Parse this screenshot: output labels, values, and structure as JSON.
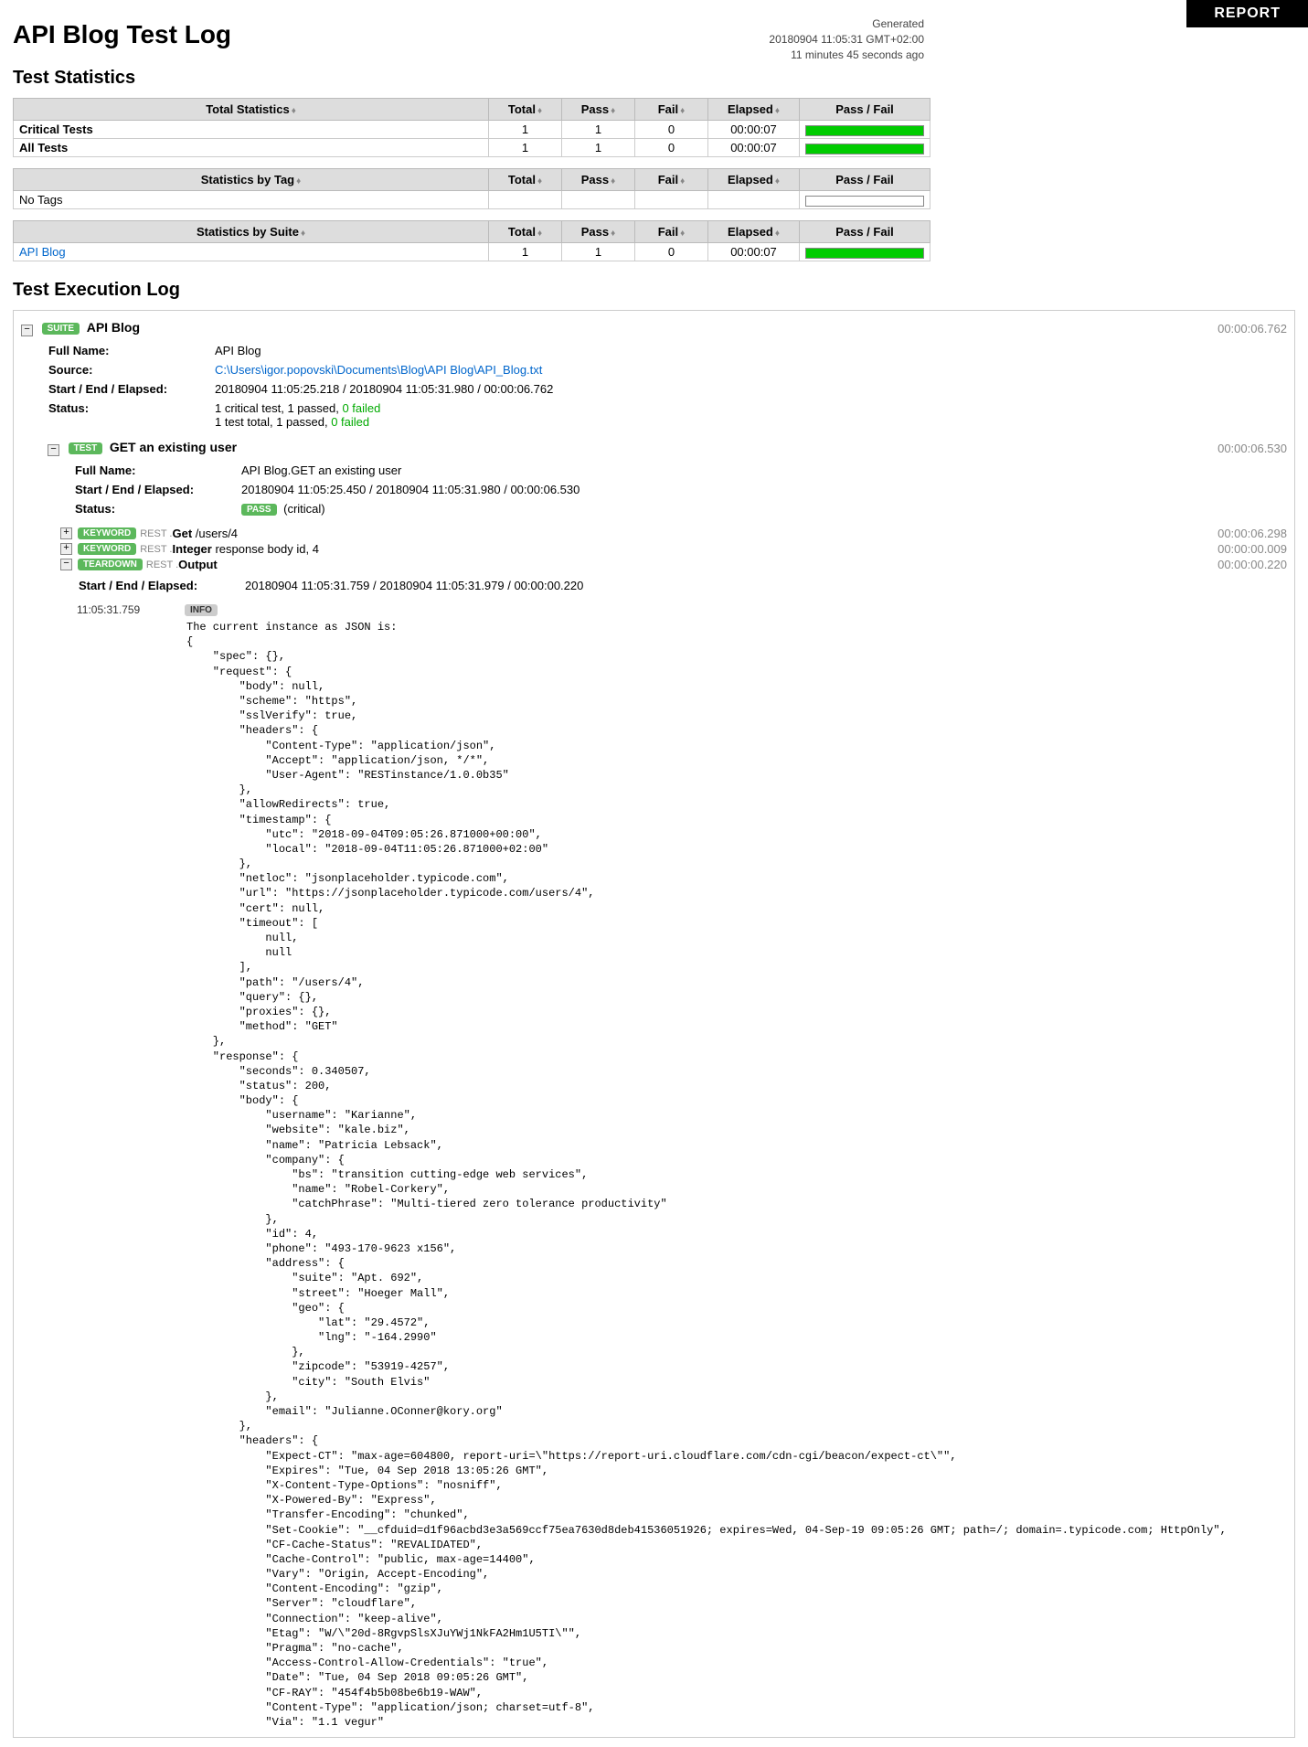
{
  "report_button": "REPORT",
  "title": "API Blog Test Log",
  "generated": {
    "label": "Generated",
    "datetime": "20180904 11:05:31 GMT+02:00",
    "ago": "11 minutes 45 seconds ago"
  },
  "sections": {
    "stats": "Test Statistics",
    "exec": "Test Execution Log"
  },
  "stat_headers": [
    "Total",
    "Pass",
    "Fail",
    "Elapsed",
    "Pass / Fail"
  ],
  "stat_group1": {
    "header": "Total Statistics",
    "rows": [
      {
        "name": "Critical Tests",
        "total": "1",
        "pass": "1",
        "fail": "0",
        "elapsed": "00:00:07",
        "bar": true
      },
      {
        "name": "All Tests",
        "total": "1",
        "pass": "1",
        "fail": "0",
        "elapsed": "00:00:07",
        "bar": true
      }
    ]
  },
  "stat_group2": {
    "header": "Statistics by Tag",
    "rows": [
      {
        "name": "No Tags",
        "total": "",
        "pass": "",
        "fail": "",
        "elapsed": "",
        "bar": false
      }
    ]
  },
  "stat_group3": {
    "header": "Statistics by Suite",
    "rows": [
      {
        "name": "API Blog",
        "link": true,
        "total": "1",
        "pass": "1",
        "fail": "0",
        "elapsed": "00:00:07",
        "bar": true
      }
    ]
  },
  "suite": {
    "badge": "SUITE",
    "name": "API Blog",
    "elapsed": "00:00:06.762",
    "full_name_label": "Full Name:",
    "full_name": "API Blog",
    "source_label": "Source:",
    "source": "C:\\Users\\igor.popovski\\Documents\\Blog\\API Blog\\API_Blog.txt",
    "see_label": "Start / End / Elapsed:",
    "see": "20180904 11:05:25.218 / 20180904 11:05:31.980 / 00:00:06.762",
    "status_label": "Status:",
    "status_line1a": "1 critical test, 1 passed, ",
    "status_line1b": "0 failed",
    "status_line2a": "1 test total, 1 passed, ",
    "status_line2b": "0 failed"
  },
  "test": {
    "badge": "TEST",
    "name": "GET an existing user",
    "elapsed": "00:00:06.530",
    "full_name_label": "Full Name:",
    "full_name": "API Blog.GET an existing user",
    "see_label": "Start / End / Elapsed:",
    "see": "20180904 11:05:25.450 / 20180904 11:05:31.980 / 00:00:06.530",
    "status_label": "Status:",
    "status_badge": "PASS",
    "status_extra": "(critical)"
  },
  "kw1": {
    "badge": "KEYWORD",
    "lib": "REST .",
    "name": "Get",
    "args": "/users/4",
    "elapsed": "00:00:06.298"
  },
  "kw2": {
    "badge": "KEYWORD",
    "lib": "REST .",
    "name": "Integer",
    "args": "response body id, 4",
    "elapsed": "00:00:00.009"
  },
  "teardown": {
    "badge": "TEARDOWN",
    "lib": "REST .",
    "name": "Output",
    "elapsed": "00:00:00.220",
    "see_label": "Start / End / Elapsed:",
    "see": "20180904 11:05:31.759 / 20180904 11:05:31.979 / 00:00:00.220",
    "timestamp": "11:05:31.759",
    "info_badge": "INFO"
  },
  "json_output": "The current instance as JSON is:\n{\n    \"spec\": {},\n    \"request\": {\n        \"body\": null,\n        \"scheme\": \"https\",\n        \"sslVerify\": true,\n        \"headers\": {\n            \"Content-Type\": \"application/json\",\n            \"Accept\": \"application/json, */*\",\n            \"User-Agent\": \"RESTinstance/1.0.0b35\"\n        },\n        \"allowRedirects\": true,\n        \"timestamp\": {\n            \"utc\": \"2018-09-04T09:05:26.871000+00:00\",\n            \"local\": \"2018-09-04T11:05:26.871000+02:00\"\n        },\n        \"netloc\": \"jsonplaceholder.typicode.com\",\n        \"url\": \"https://jsonplaceholder.typicode.com/users/4\",\n        \"cert\": null,\n        \"timeout\": [\n            null,\n            null\n        ],\n        \"path\": \"/users/4\",\n        \"query\": {},\n        \"proxies\": {},\n        \"method\": \"GET\"\n    },\n    \"response\": {\n        \"seconds\": 0.340507,\n        \"status\": 200,\n        \"body\": {\n            \"username\": \"Karianne\",\n            \"website\": \"kale.biz\",\n            \"name\": \"Patricia Lebsack\",\n            \"company\": {\n                \"bs\": \"transition cutting-edge web services\",\n                \"name\": \"Robel-Corkery\",\n                \"catchPhrase\": \"Multi-tiered zero tolerance productivity\"\n            },\n            \"id\": 4,\n            \"phone\": \"493-170-9623 x156\",\n            \"address\": {\n                \"suite\": \"Apt. 692\",\n                \"street\": \"Hoeger Mall\",\n                \"geo\": {\n                    \"lat\": \"29.4572\",\n                    \"lng\": \"-164.2990\"\n                },\n                \"zipcode\": \"53919-4257\",\n                \"city\": \"South Elvis\"\n            },\n            \"email\": \"Julianne.OConner@kory.org\"\n        },\n        \"headers\": {\n            \"Expect-CT\": \"max-age=604800, report-uri=\\\"https://report-uri.cloudflare.com/cdn-cgi/beacon/expect-ct\\\"\",\n            \"Expires\": \"Tue, 04 Sep 2018 13:05:26 GMT\",\n            \"X-Content-Type-Options\": \"nosniff\",\n            \"X-Powered-By\": \"Express\",\n            \"Transfer-Encoding\": \"chunked\",\n            \"Set-Cookie\": \"__cfduid=d1f96acbd3e3a569ccf75ea7630d8deb41536051926; expires=Wed, 04-Sep-19 09:05:26 GMT; path=/; domain=.typicode.com; HttpOnly\",\n            \"CF-Cache-Status\": \"REVALIDATED\",\n            \"Cache-Control\": \"public, max-age=14400\",\n            \"Vary\": \"Origin, Accept-Encoding\",\n            \"Content-Encoding\": \"gzip\",\n            \"Server\": \"cloudflare\",\n            \"Connection\": \"keep-alive\",\n            \"Etag\": \"W/\\\"20d-8RgvpSlsXJuYWj1NkFA2Hm1U5TI\\\"\",\n            \"Pragma\": \"no-cache\",\n            \"Access-Control-Allow-Credentials\": \"true\",\n            \"Date\": \"Tue, 04 Sep 2018 09:05:26 GMT\",\n            \"CF-RAY\": \"454f4b5b08be6b19-WAW\",\n            \"Content-Type\": \"application/json; charset=utf-8\",\n            \"Via\": \"1.1 vegur\""
}
